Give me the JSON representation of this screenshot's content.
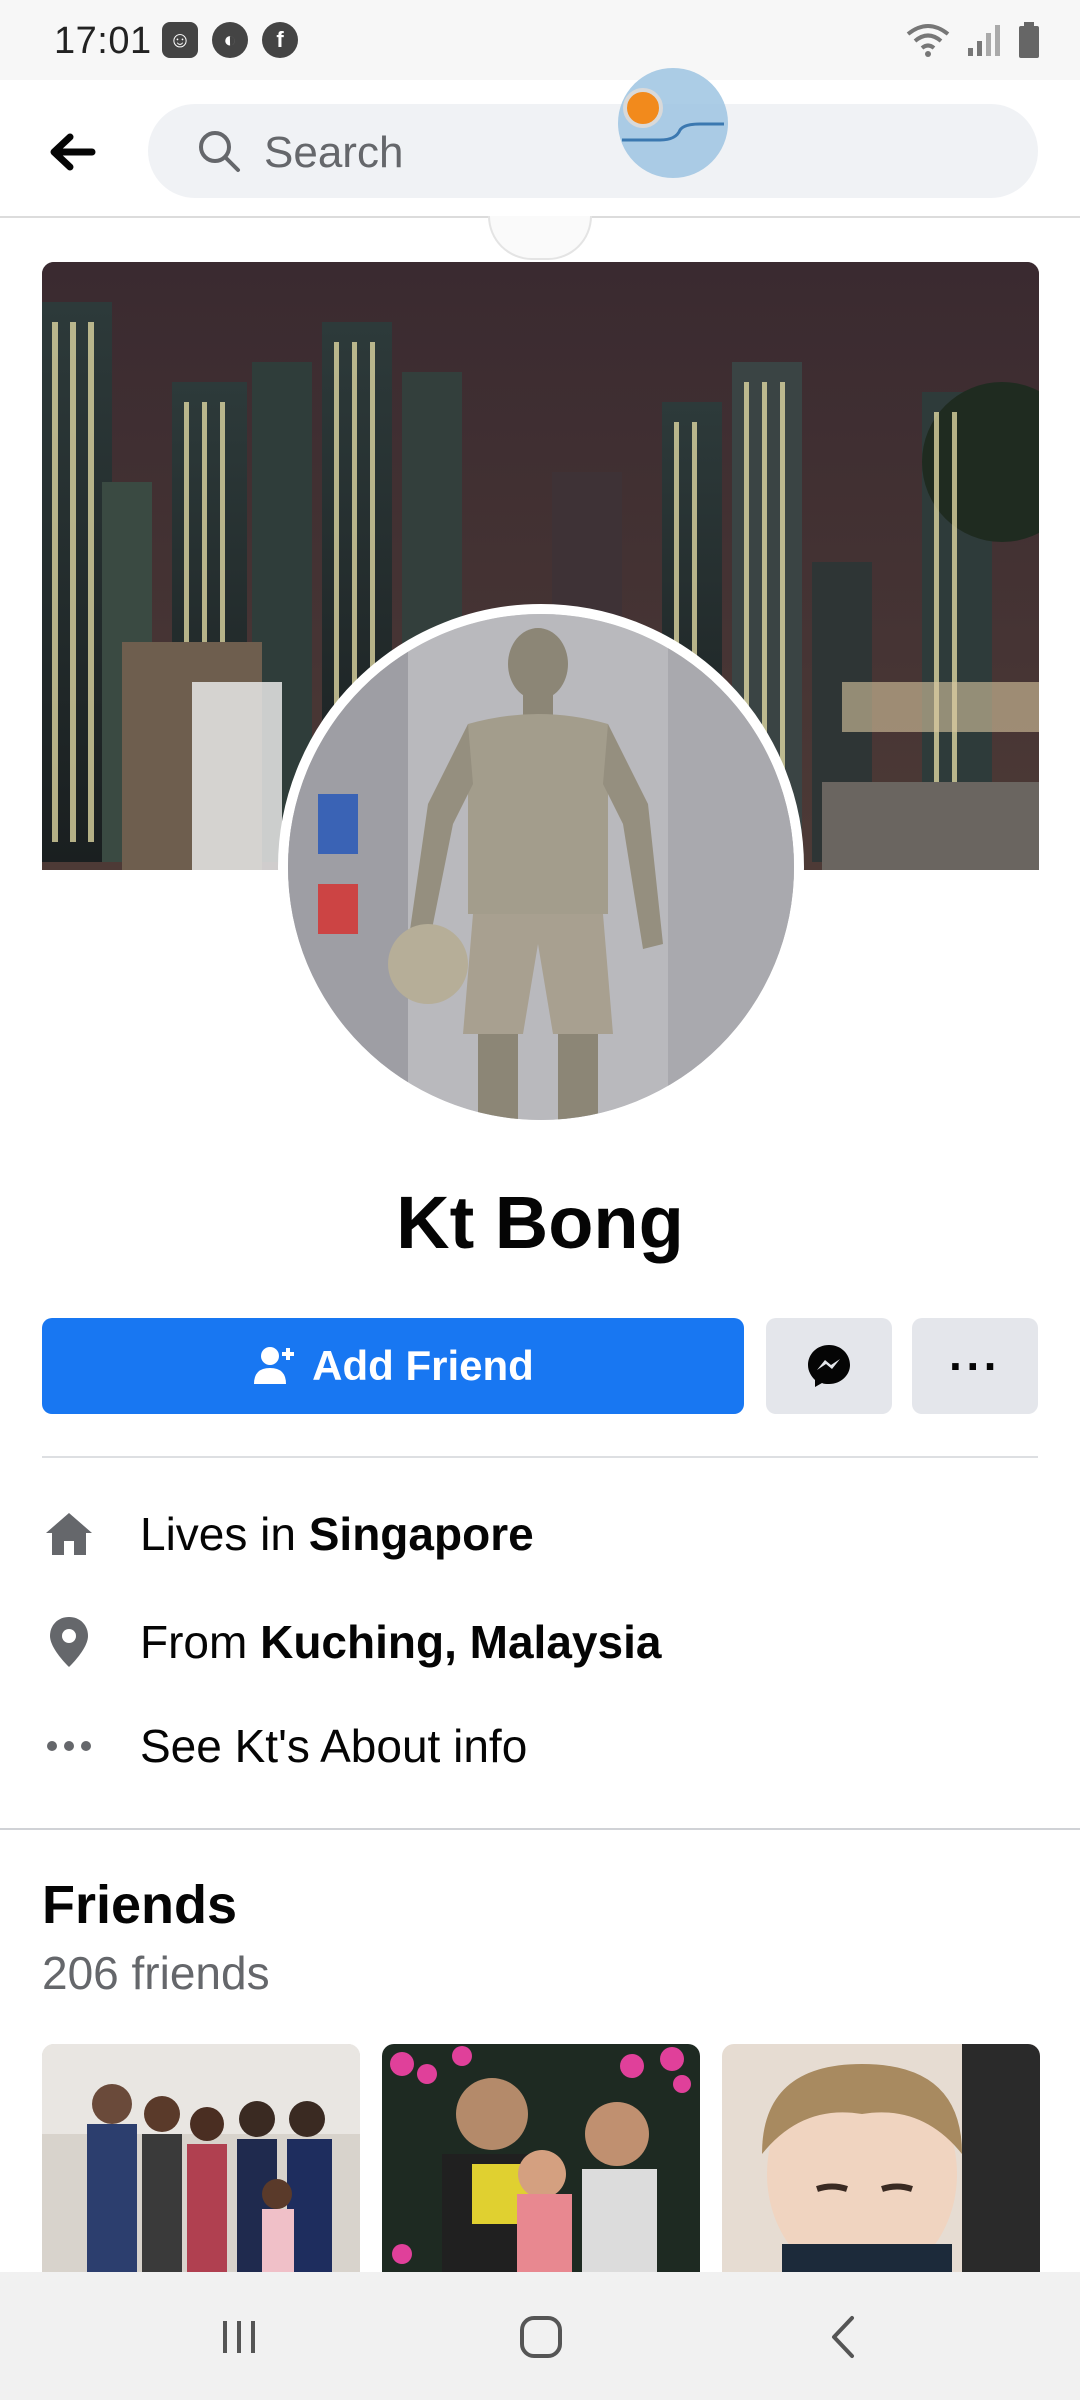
{
  "status_bar": {
    "time": "17:01"
  },
  "search": {
    "placeholder": "Search"
  },
  "profile": {
    "name": "Kt Bong",
    "add_friend_label": "Add Friend",
    "more_label": "···"
  },
  "intro": {
    "lives_prefix": "Lives in ",
    "lives_place": "Singapore",
    "from_prefix": "From ",
    "from_place": "Kuching, Malaysia",
    "about_label": "See Kt's About info"
  },
  "friends": {
    "title": "Friends",
    "count": "206 friends"
  },
  "colors": {
    "brand": "#1877f2",
    "secondary_button": "#e4e6eb",
    "overlay_accent": "#f28a1c"
  },
  "icons": {
    "back": "arrow-left-icon",
    "search": "search-icon",
    "add_friend": "person-add-icon",
    "messenger": "messenger-icon",
    "more": "ellipsis-icon",
    "home": "home-icon",
    "location": "location-pin-icon",
    "about": "ellipsis-icon"
  }
}
